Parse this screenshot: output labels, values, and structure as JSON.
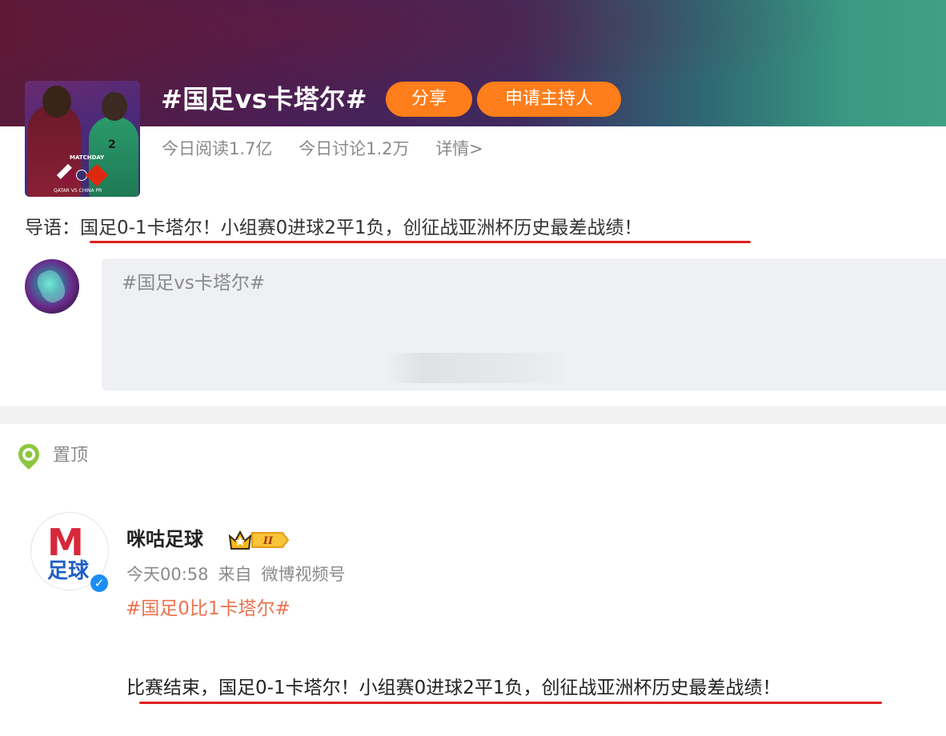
{
  "topic": {
    "title": "#国足vs卡塔尔#",
    "share_label": "分享",
    "apply_host_label": "申请主持人",
    "stats": {
      "reads": "今日阅读1.7亿",
      "discussions": "今日讨论1.2万",
      "details": "详情>"
    },
    "cover": {
      "matchday": "MATCHDAY",
      "jersey_number": "2",
      "footer": "QATAR VS CHINA PR"
    }
  },
  "intro": {
    "label": "导语：",
    "text": "国足0-1卡塔尔！小组赛0进球2平1负，创征战亚洲杯历史最差战绩！"
  },
  "composer": {
    "prefill": "#国足vs卡塔尔#"
  },
  "pinned": {
    "label": "置顶"
  },
  "post": {
    "author": "咪咕足球",
    "avatar_text": "足球",
    "level_badge": "II",
    "time": "今天00:58",
    "source_prefix": "来自",
    "source": "微博视频号",
    "hashtag": "#国足0比1卡塔尔#",
    "body": "比赛结束，国足0-1卡塔尔！小组赛0进球2平1负，创征战亚洲杯历史最差战绩！"
  },
  "colors": {
    "accent_orange": "#ff7d1a",
    "hashtag": "#eb7350",
    "underline_red": "#e0201e",
    "verified_blue": "#1a8ef5"
  },
  "icons": [
    "pin-icon",
    "crown-level-icon",
    "verified-icon"
  ]
}
